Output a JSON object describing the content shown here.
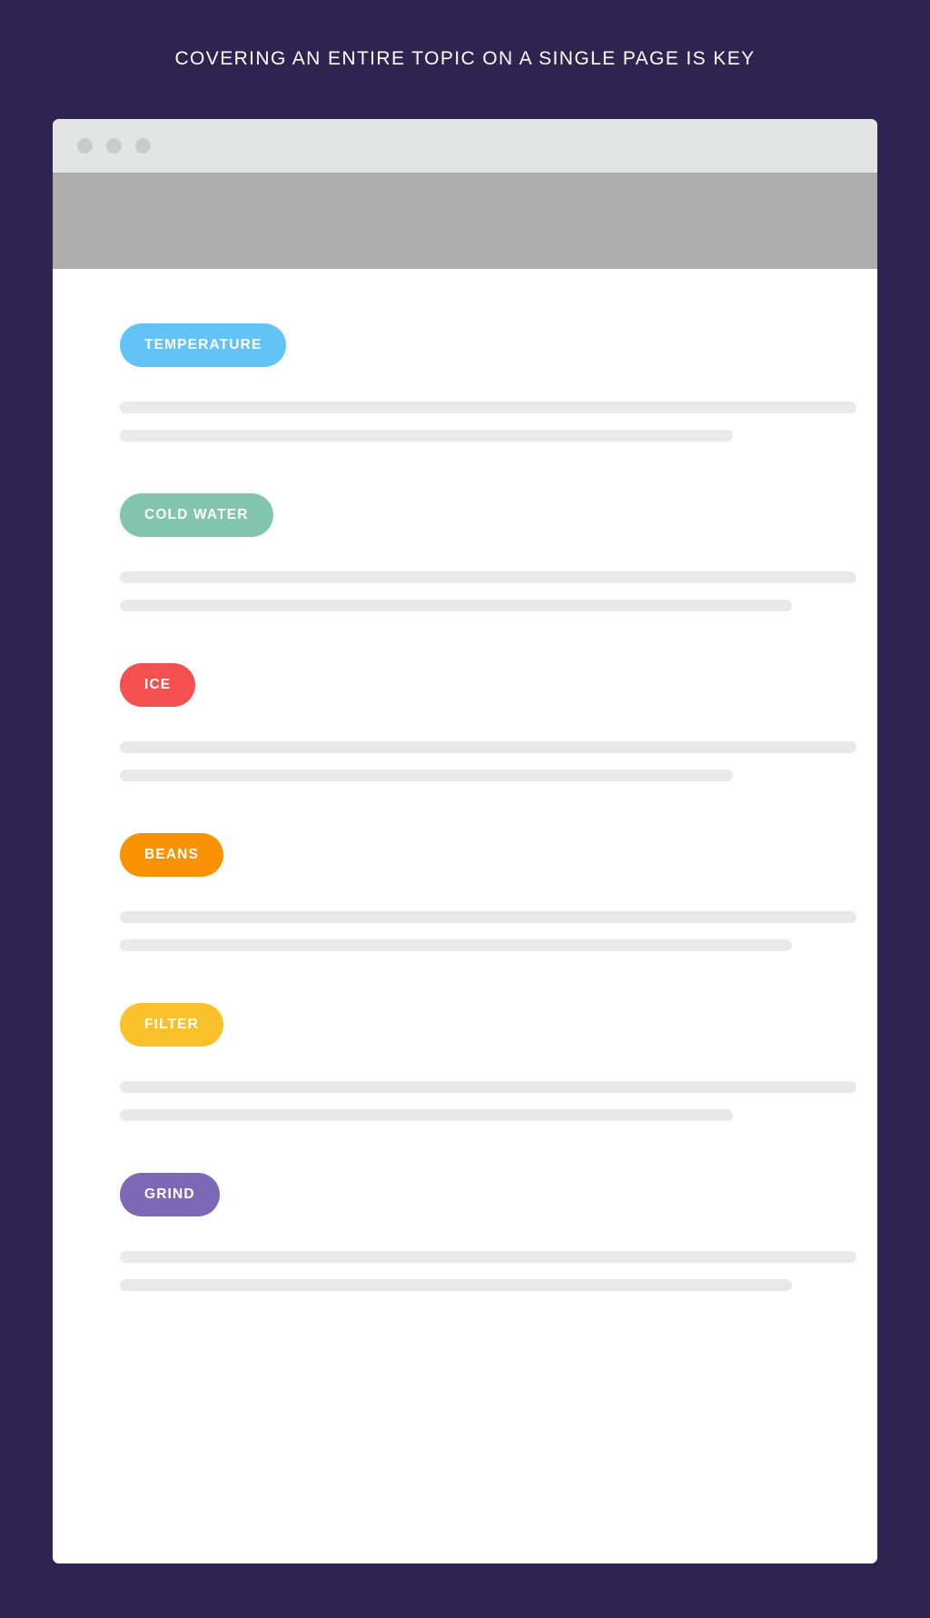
{
  "headline": "COVERING AN ENTIRE TOPIC ON A SINGLE PAGE IS KEY",
  "colors": {
    "background": "#2E2450",
    "card": "#FFFFFF",
    "titlebar": "#E3E5E5",
    "window_dot": "#C9CBCB",
    "hero_banner": "#ADADAD",
    "skeleton": "#E9E9E9",
    "pill_text": "#FFFFFF"
  },
  "browser_window": {
    "dots": [
      "window-dot-1",
      "window-dot-2",
      "window-dot-3"
    ],
    "hero_banner_label": "hero-image-placeholder"
  },
  "sections": [
    {
      "label": "TEMPERATURE",
      "color": "#62C3F7",
      "skeleton_widths": [
        "811px",
        "675px"
      ]
    },
    {
      "label": "COLD WATER",
      "color": "#82C4AE",
      "skeleton_widths": [
        "811px",
        "740px"
      ]
    },
    {
      "label": "ICE",
      "color": "#F55050",
      "skeleton_widths": [
        "811px",
        "675px"
      ]
    },
    {
      "label": "BEANS",
      "color": "#F99200",
      "skeleton_widths": [
        "811px",
        "740px"
      ]
    },
    {
      "label": "FILTER",
      "color": "#FAC12B",
      "skeleton_widths": [
        "811px",
        "675px"
      ]
    },
    {
      "label": "GRIND",
      "color": "#7D68B7",
      "skeleton_widths": [
        "811px",
        "740px"
      ]
    }
  ]
}
